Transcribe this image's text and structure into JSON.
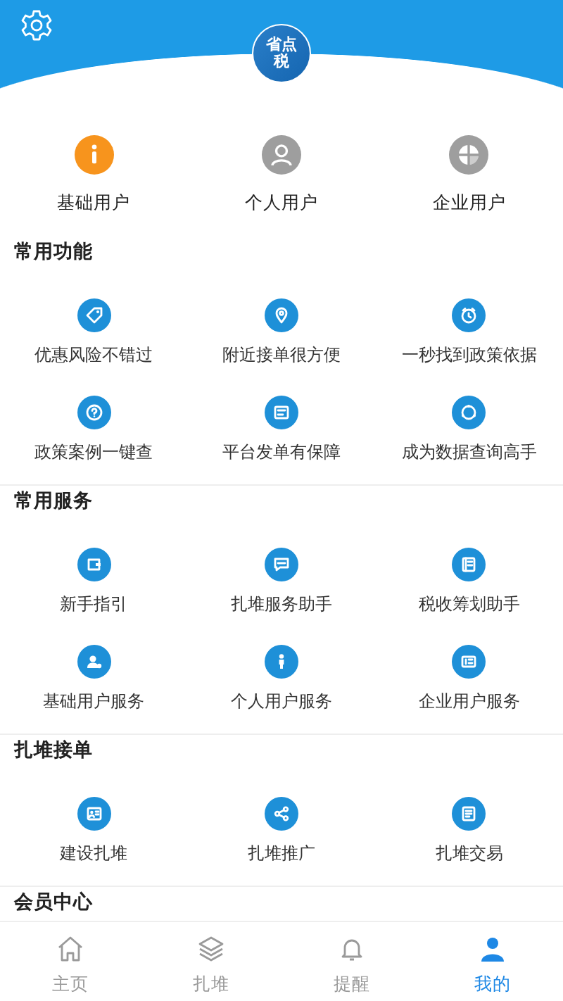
{
  "header": {
    "logo_text": "省点税"
  },
  "user_types": [
    {
      "label": "基础用户",
      "color": "#f7941d"
    },
    {
      "label": "个人用户",
      "color": "#9e9e9e"
    },
    {
      "label": "企业用户",
      "color": "#9e9e9e"
    }
  ],
  "sections": [
    {
      "title": "常用功能",
      "items": [
        "优惠风险不错过",
        "附近接单很方便",
        "一秒找到政策依据",
        "政策案例一键查",
        "平台发单有保障",
        "成为数据查询高手"
      ]
    },
    {
      "title": "常用服务",
      "items": [
        "新手指引",
        "扎堆服务助手",
        "税收筹划助手",
        "基础用户服务",
        "个人用户服务",
        "企业用户服务"
      ]
    },
    {
      "title": "扎堆接单",
      "items": [
        "建设扎堆",
        "扎堆推广",
        "扎堆交易"
      ]
    },
    {
      "title": "会员中心"
    }
  ],
  "tab_bar": [
    {
      "label": "主页",
      "selected": false
    },
    {
      "label": "扎堆",
      "selected": false
    },
    {
      "label": "提醒",
      "selected": false
    },
    {
      "label": "我的",
      "selected": true
    }
  ]
}
